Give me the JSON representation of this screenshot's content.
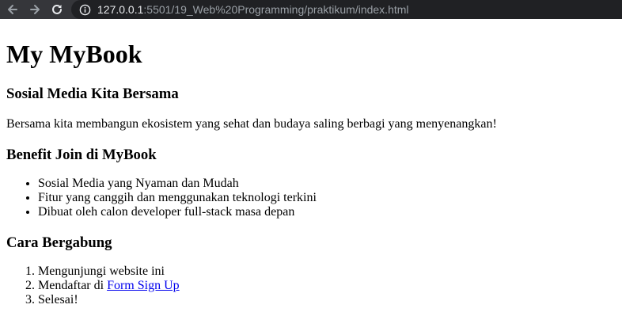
{
  "browser": {
    "url_host": "127.0.0.1",
    "url_rest": ":5501/19_Web%20Programming/praktikum/index.html"
  },
  "page": {
    "title": "My MyBook",
    "intro_heading": "Sosial Media Kita Bersama",
    "intro_text": "Bersama kita membangun ekosistem yang sehat dan budaya saling berbagi yang menyenangkan!",
    "benefit_heading": "Benefit Join di MyBook",
    "benefits": [
      "Sosial Media yang Nyaman dan Mudah",
      "Fitur yang canggih dan menggunakan teknologi terkini",
      "Dibuat oleh calon developer full-stack masa depan"
    ],
    "join_heading": "Cara Bergabung",
    "steps": {
      "step1": "Mengunjungi website ini",
      "step2_prefix": "Mendaftar di ",
      "step2_link": "Form Sign Up",
      "step3": "Selesai!"
    }
  },
  "colors": {
    "toolbar": "#35363a",
    "omnibox": "#202124",
    "link": "#0000ee"
  }
}
